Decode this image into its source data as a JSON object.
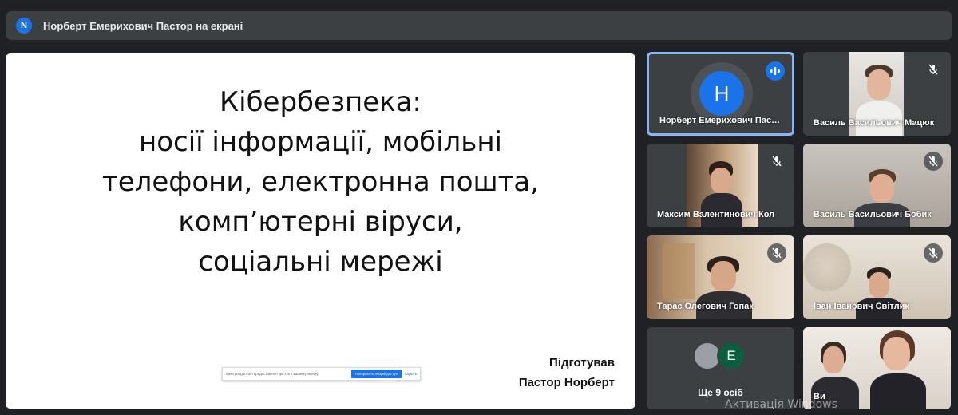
{
  "banner": {
    "avatar_letter": "N",
    "text": "Норберт Емерихович Пастор на екрані"
  },
  "slide": {
    "title_lines": [
      "Кібербезпека:",
      "носії інформації, мобільні",
      "телефони, електронна пошта,",
      "комп’ютерні віруси,",
      "соціальні мережі"
    ],
    "credit_lines": [
      "Підготував",
      "Пастор Норберт"
    ],
    "share_bar": {
      "text": "meet.google.com предоставляет доступ к вашему экрану.",
      "stop_label": "Прекратить общий доступ",
      "hide_label": "Скрыть"
    }
  },
  "participants": [
    {
      "name": "Норберт Емерихович Пастор",
      "avatar_letter": "H",
      "status_icon": "speaking-icon",
      "active": true
    },
    {
      "name": "Василь Васильович Мацюк",
      "status_icon": "mic-off-icon"
    },
    {
      "name": "Максим Валентинович Кол",
      "status_icon": "mic-off-icon"
    },
    {
      "name": "Василь Васильович Бобик",
      "status_icon": "mic-off-icon"
    },
    {
      "name": "Тарас Олегович Гопак",
      "status_icon": "mic-off-icon"
    },
    {
      "name": "Іван Іванович Світлик",
      "status_icon": "mic-off-icon"
    },
    {
      "name": "Ще 9 осіб",
      "avatar_letter": "E"
    },
    {
      "name": "Ви"
    }
  ],
  "watermark": "Активація Windows",
  "colors": {
    "background": "#202124",
    "tile": "#3c4043",
    "accent_blue": "#1a73e8",
    "active_border": "#8ab4f8",
    "green_avatar": "#0b5e40"
  }
}
